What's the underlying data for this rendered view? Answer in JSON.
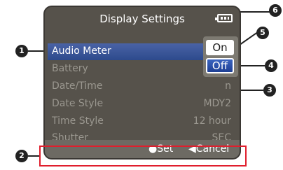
{
  "screen": {
    "title": "Display Settings",
    "battery_icon": "battery-icon"
  },
  "menu": {
    "rows": [
      {
        "label": "Audio Meter",
        "value": ""
      },
      {
        "label": "Battery",
        "value": ""
      },
      {
        "label": "Date/Time",
        "value": "n"
      },
      {
        "label": "Date Style",
        "value": "MDY2"
      },
      {
        "label": "Time Style",
        "value": "12 hour"
      },
      {
        "label": "Shutter",
        "value": "SEC"
      }
    ]
  },
  "popup": {
    "on_label": "On",
    "off_label": "Off"
  },
  "bottom_bar": {
    "set_label": "●Set",
    "cancel_label": "◀Cancel"
  },
  "callouts": [
    "1",
    "2",
    "3",
    "4",
    "5",
    "6"
  ],
  "colors": {
    "selection": "#3b5aa4",
    "highlight_box": "#e01e2d",
    "screen_bg": "#56524b"
  }
}
